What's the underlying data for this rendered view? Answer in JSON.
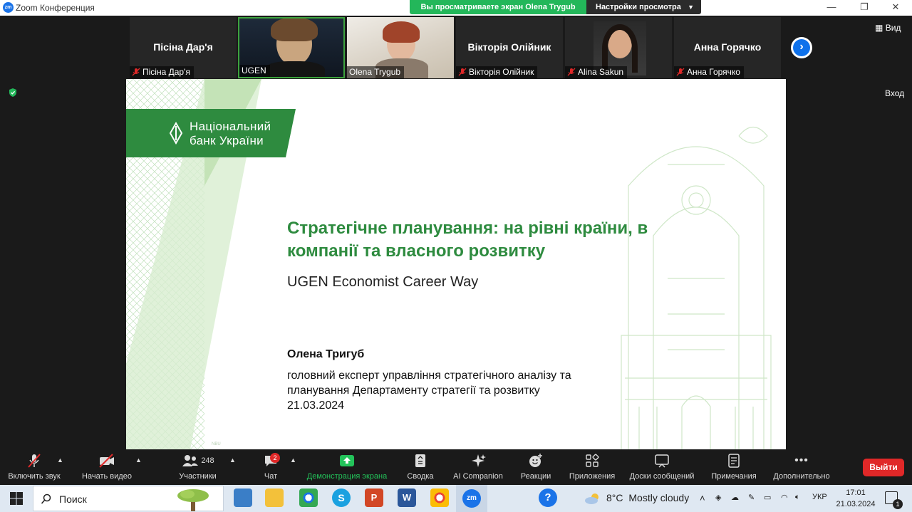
{
  "titlebar": {
    "app_title": "Zoom Конференция",
    "logo_text": "zm",
    "minimize": "—",
    "maximize": "❐",
    "close": "✕"
  },
  "share_banner": {
    "viewing_text": "Вы просматриваете экран Olena Trygub",
    "view_settings_label": "Настройки просмотра"
  },
  "gallery": {
    "tiles": [
      {
        "big_name": "Пісіна Дар'я",
        "name": "Пісіна Дар'я",
        "muted": true,
        "video": false
      },
      {
        "big_name": "",
        "name": "UGEN",
        "muted": false,
        "video": true,
        "active": true
      },
      {
        "big_name": "",
        "name": "Olena Trygub",
        "muted": false,
        "video": true
      },
      {
        "big_name": "Вікторія Олійник",
        "name": "Вікторія Олійник",
        "muted": true,
        "video": false
      },
      {
        "big_name": "",
        "name": "Alina Sakun",
        "muted": true,
        "video": false,
        "photo": true
      },
      {
        "big_name": "Анна Горячко",
        "name": "Анна Горячко",
        "muted": true,
        "video": false
      }
    ],
    "next_icon": "›",
    "view_label": "Вид",
    "exit_label": "Вход"
  },
  "slide": {
    "logo_line1": "Національний",
    "logo_line2": "банк України",
    "title": "Стратегічне планування: на рівні країни, в компанії та власного розвитку",
    "subtitle": "UGEN Economist Career Way",
    "speaker_name": "Олена Тригуб",
    "speaker_role": "головний експерт управління стратегічного аналізу та планування Департаменту стратегії та розвитку",
    "date": "21.03.2024"
  },
  "toolbar": {
    "items": [
      {
        "label": "Включить звук",
        "icon": "muted-mic-icon"
      },
      {
        "label": "Начать видео",
        "icon": "video-off-icon"
      },
      {
        "label": "Участники",
        "icon": "participants-icon",
        "count": "248"
      },
      {
        "label": "Чат",
        "icon": "chat-icon",
        "badge": "2"
      },
      {
        "label": "Демонстрация экрана",
        "icon": "share-screen-icon"
      },
      {
        "label": "Сводка",
        "icon": "summary-icon"
      },
      {
        "label": "AI Companion",
        "icon": "ai-sparkle-icon"
      },
      {
        "label": "Реакции",
        "icon": "reactions-icon"
      },
      {
        "label": "Приложения",
        "icon": "apps-icon"
      },
      {
        "label": "Доски сообщений",
        "icon": "whiteboard-icon"
      },
      {
        "label": "Примечания",
        "icon": "notes-icon"
      },
      {
        "label": "Дополнительно",
        "icon": "more-icon"
      }
    ],
    "more_glyph": "•••",
    "leave_label": "Выйти",
    "colors": {
      "share_green": "#23c35a",
      "leave_red": "#e02828",
      "zoom_blue": "#0e71eb"
    }
  },
  "taskbar": {
    "search_placeholder": "Поиск",
    "weather_temp": "8°C",
    "weather_text": "Mostly cloudy",
    "language": "УКР",
    "time": "17:01",
    "date": "21.03.2024",
    "notification_count": "1",
    "zoom_app_text": "zm",
    "help_glyph": "?"
  }
}
